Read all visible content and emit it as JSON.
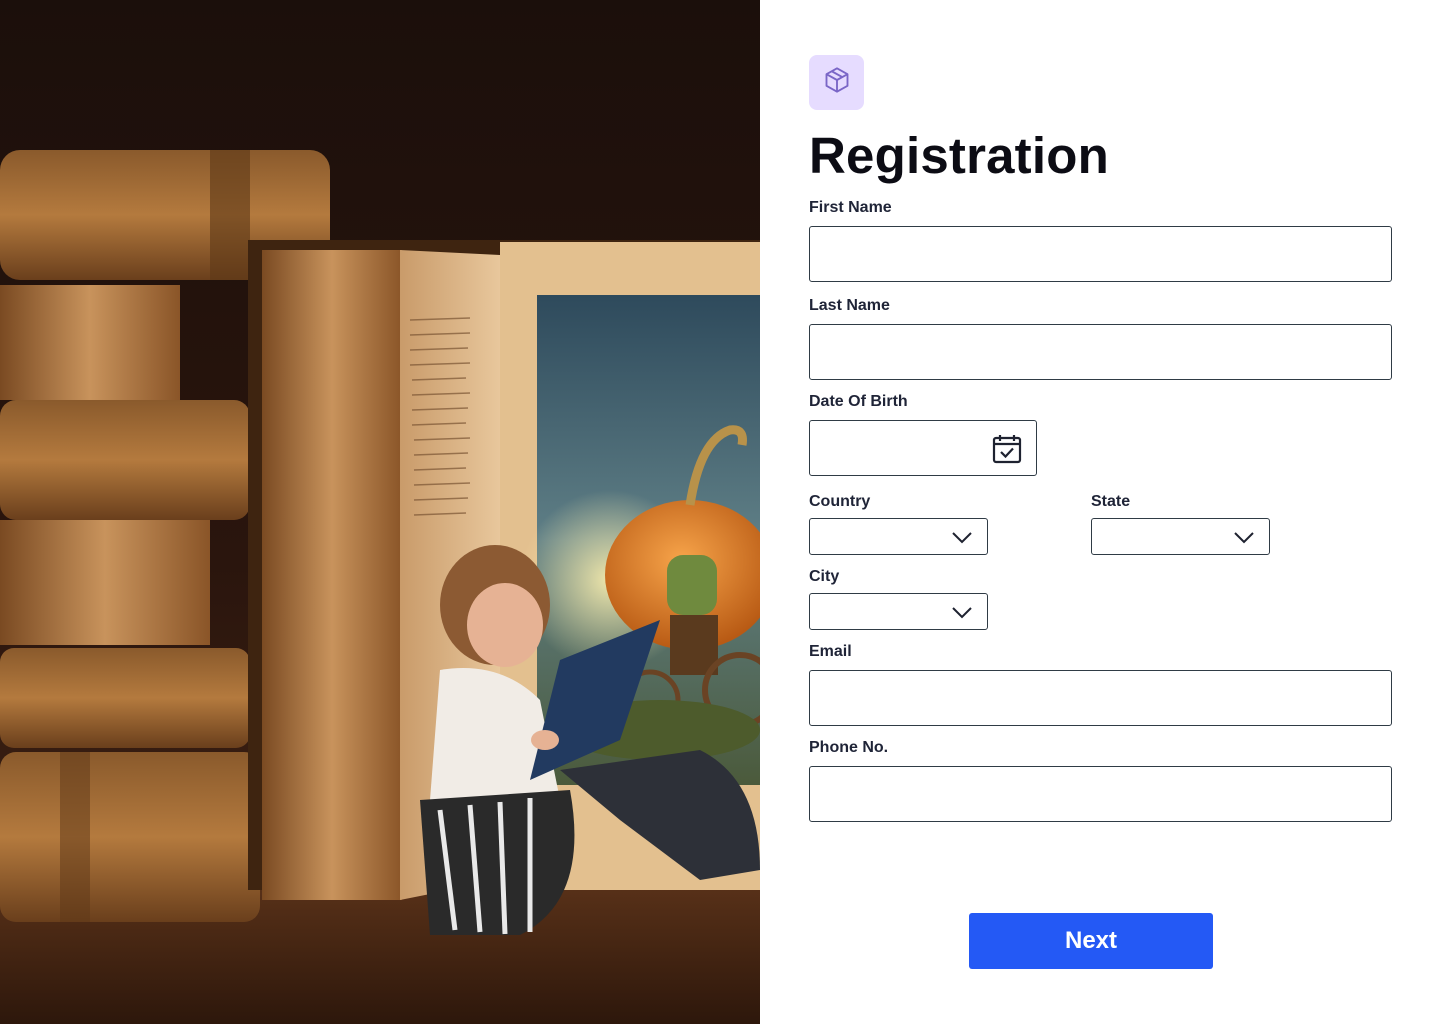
{
  "hero": {
    "image": "illustration: stack of antique books and a girl reading inside a giant open book with a pumpkin carriage"
  },
  "form": {
    "logo_icon": "cube-icon",
    "title": "Registration",
    "first_name_label": "First Name",
    "last_name_label": "Last Name",
    "dob_label": "Date Of Birth",
    "dob_icon": "calendar-check-icon",
    "country_label": "Country",
    "state_label": "State",
    "city_label": "City",
    "email_label": "Email",
    "phone_label": "Phone No.",
    "next_label": "Next",
    "colors": {
      "accent": "#2459f5",
      "logo_bg": "#e6dcff",
      "border": "#2f3b45"
    }
  }
}
